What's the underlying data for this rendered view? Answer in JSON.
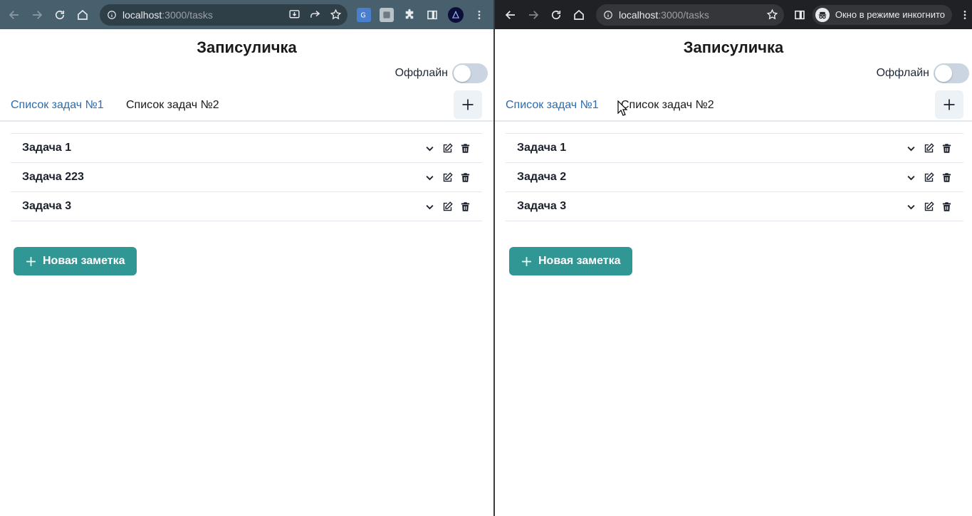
{
  "left_window": {
    "url_host": "localhost",
    "url_rest": ":3000/tasks",
    "app_title": "Записуличка",
    "offline_label": "Оффлайн",
    "tabs": [
      {
        "label": "Список задач №1",
        "active": true
      },
      {
        "label": "Список задач №2",
        "active": false
      }
    ],
    "tasks": [
      {
        "title": "Задача 1"
      },
      {
        "title": "Задача 223"
      },
      {
        "title": "Задача 3"
      }
    ],
    "new_note_label": "Новая заметка"
  },
  "right_window": {
    "url_host": "localhost",
    "url_rest": ":3000/tasks",
    "incognito_label": "Окно в режиме инкогнито",
    "app_title": "Записуличка",
    "offline_label": "Оффлайн",
    "tabs": [
      {
        "label": "Список задач №1",
        "active": true
      },
      {
        "label": "Список задач №2",
        "active": false
      }
    ],
    "tasks": [
      {
        "title": "Задача 1"
      },
      {
        "title": "Задача 2"
      },
      {
        "title": "Задача 3"
      }
    ],
    "new_note_label": "Новая заметка"
  },
  "colors": {
    "chrome_normal": "#48606e",
    "chrome_incognito": "#202124",
    "active_tab": "#2b6cb0",
    "new_note_button": "#319795",
    "toggle_off": "#cbd5e1"
  },
  "offline_toggle_on": false
}
